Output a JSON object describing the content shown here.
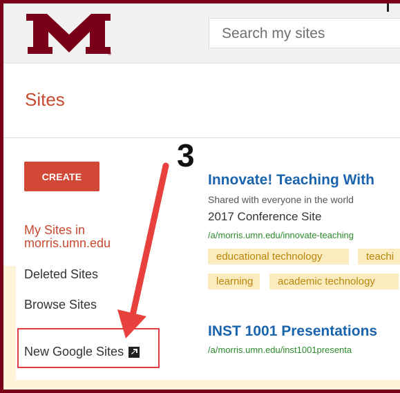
{
  "header": {
    "search_placeholder": "Search my sites"
  },
  "page": {
    "title": "Sites"
  },
  "sidebar": {
    "create_label": "CREATE",
    "my_sites_line1": "My Sites in",
    "my_sites_line2": "morris.umn.edu",
    "deleted_label": "Deleted Sites",
    "browse_label": "Browse Sites",
    "new_google_sites_label": "New Google Sites"
  },
  "annotation": {
    "step_number": "3"
  },
  "sites": [
    {
      "title": "Innovate! Teaching With",
      "shared": "Shared with everyone in the world",
      "description": "2017 Conference Site",
      "url": "/a/morris.umn.edu/innovate-teaching",
      "tags": [
        "educational technology",
        "teachi",
        "learning",
        "academic technology"
      ]
    },
    {
      "title": "INST 1001 Presentations",
      "url": "/a/morris.umn.edu/inst1001presenta"
    }
  ],
  "colors": {
    "brand_maroon": "#7a0019",
    "create_red": "#d14836",
    "title_red": "#c64a30",
    "link_blue": "#1a63ad",
    "url_green": "#2a8a2a",
    "tag_bg": "#fbecc0",
    "annotation_red": "#e0403d"
  }
}
